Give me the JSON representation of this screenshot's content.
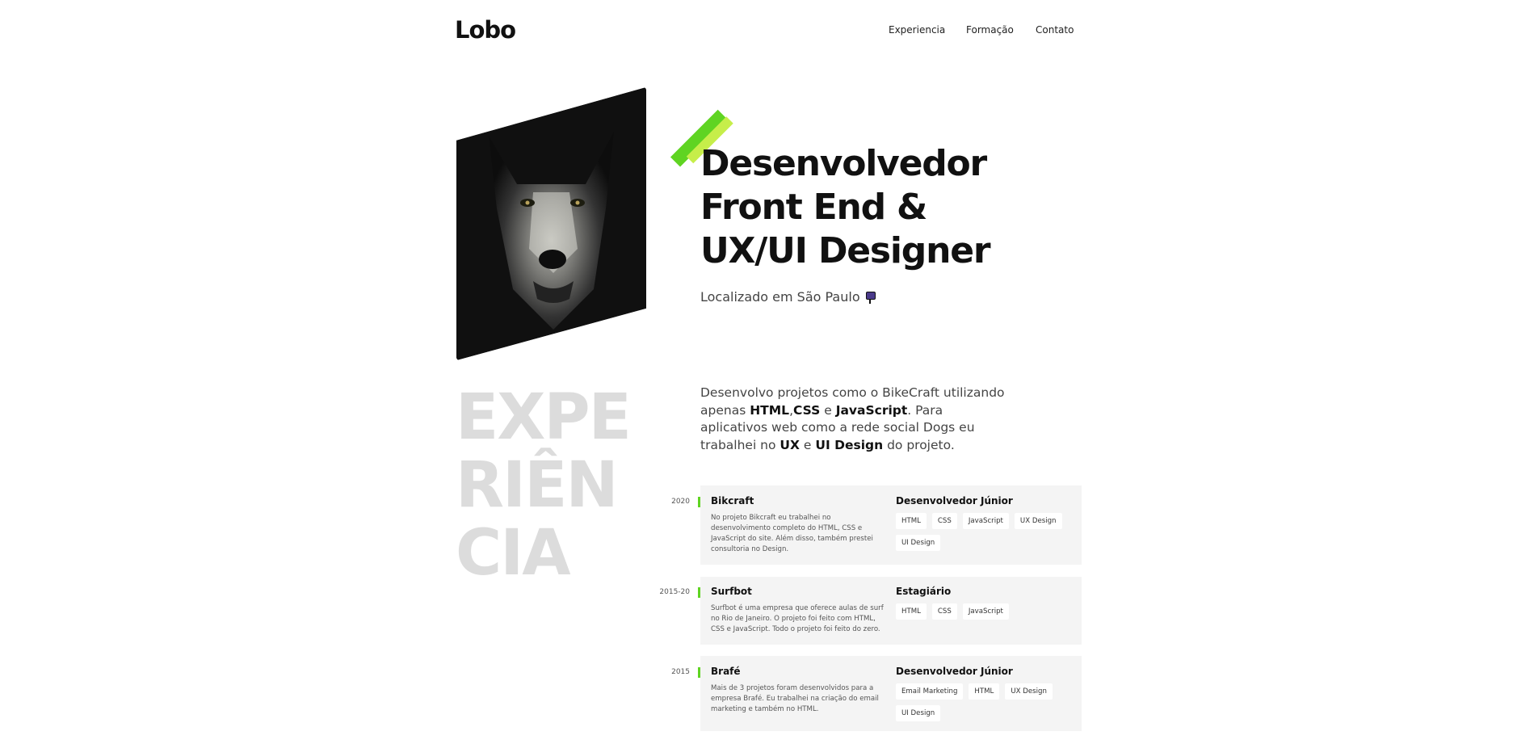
{
  "header": {
    "logo": "Lobo",
    "nav": [
      "Experiencia",
      "Formação",
      "Contato"
    ]
  },
  "hero": {
    "title_lines": [
      "Desenvolvedor",
      "Front End &",
      "UX/UI Designer"
    ],
    "location": "Localizado em São Paulo",
    "photo_alt": "wolf-photo"
  },
  "experience": {
    "section_title_lines": [
      "EXPE",
      "RIÊN",
      "CIA"
    ],
    "intro": {
      "p1": "Desenvolvo projetos como o BikeCraft utilizando apenas ",
      "b1": "HTML",
      "p2": ",",
      "b2": "CSS",
      "p3": " e ",
      "b3": "JavaScript",
      "p4": ". Para aplicativos web como a rede social Dogs eu trabalhei no ",
      "b4": "UX",
      "p5": " e ",
      "b5": "UI Design",
      "p6": " do projeto."
    },
    "items": [
      {
        "year": "2020",
        "title": "Bikcraft",
        "description": "No projeto Bikcraft eu trabalhei no desenvolvimento completo do HTML, CSS e JavaScript do site. Além disso, também prestei consultoria no Design.",
        "role": "Desenvolvedor Júnior",
        "tags": [
          "HTML",
          "CSS",
          "JavaScript",
          "UX Design",
          "UI Design"
        ]
      },
      {
        "year": "2015-20",
        "title": "Surfbot",
        "description": "Surfbot é uma empresa que oferece aulas de surf no Rio de Janeiro. O projeto foi feito com HTML, CSS e JavaScript. Todo o projeto foi feito do zero.",
        "role": "Estagiário",
        "tags": [
          "HTML",
          "CSS",
          "JavaScript"
        ]
      },
      {
        "year": "2015",
        "title": "Brafé",
        "description": "Mais de 3 projetos foram desenvolvidos para a empresa Brafé. Eu trabalhei na criação do email marketing e também no HTML.",
        "role": "Desenvolvedor Júnior",
        "tags": [
          "Email Marketing",
          "HTML",
          "UX Design",
          "UI Design"
        ]
      }
    ]
  },
  "colors": {
    "accent": "#5fd422",
    "accent_light": "#c6ee4a",
    "card_bg": "#f4f4f4",
    "section_title": "#dcdcdc"
  }
}
